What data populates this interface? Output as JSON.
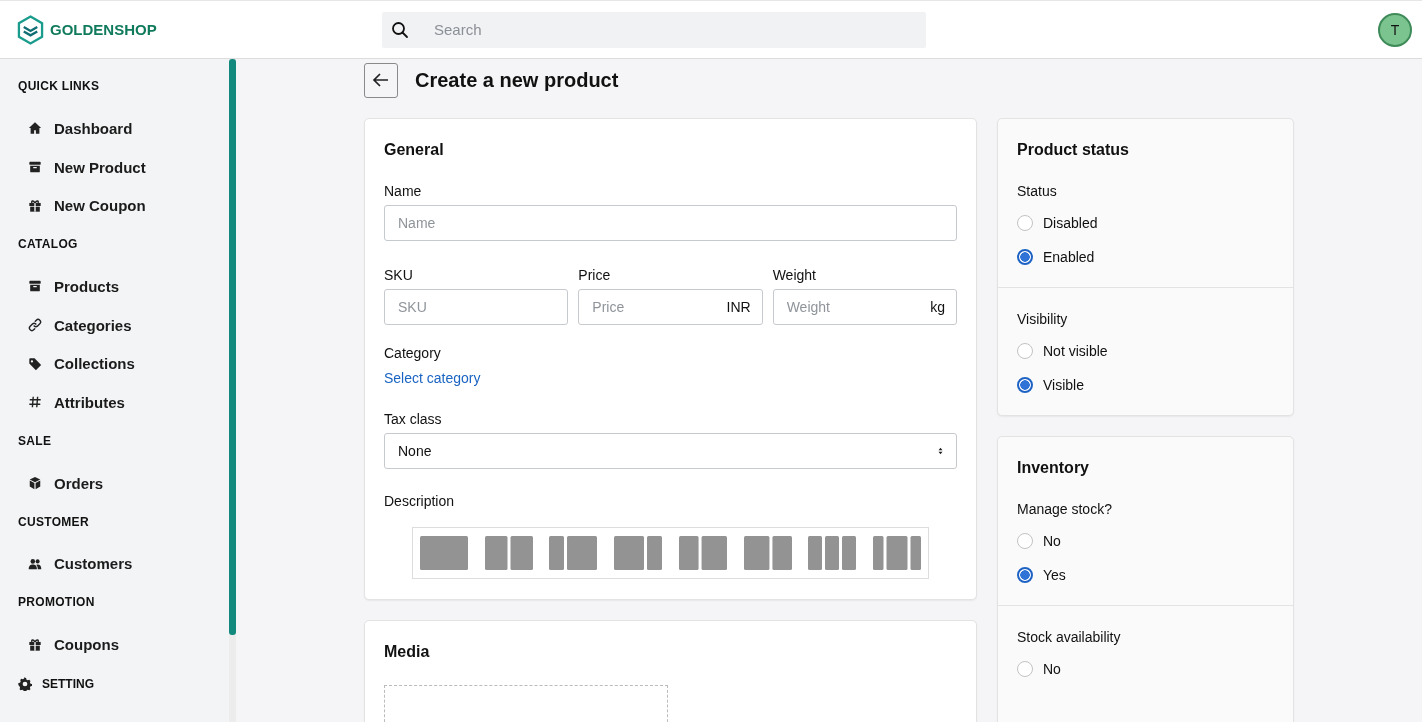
{
  "brand": {
    "name": "GOLDENSHOP"
  },
  "search": {
    "placeholder": "Search"
  },
  "user": {
    "initial": "T"
  },
  "sidebar": {
    "sections": [
      {
        "title": "QUICK LINKS",
        "items": [
          {
            "label": "Dashboard",
            "kind": "home"
          },
          {
            "label": "New Product",
            "kind": "archive"
          },
          {
            "label": "New Coupon",
            "kind": "gift"
          }
        ]
      },
      {
        "title": "CATALOG",
        "items": [
          {
            "label": "Products",
            "kind": "archive"
          },
          {
            "label": "Categories",
            "kind": "link"
          },
          {
            "label": "Collections",
            "kind": "tag"
          },
          {
            "label": "Attributes",
            "kind": "hash"
          }
        ]
      },
      {
        "title": "SALE",
        "items": [
          {
            "label": "Orders",
            "kind": "cube"
          }
        ]
      },
      {
        "title": "CUSTOMER",
        "items": [
          {
            "label": "Customers",
            "kind": "users"
          }
        ]
      },
      {
        "title": "PROMOTION",
        "items": [
          {
            "label": "Coupons",
            "kind": "gift"
          }
        ]
      }
    ],
    "setting": "SETTING"
  },
  "page": {
    "title": "Create a new product"
  },
  "general": {
    "title": "General",
    "name": {
      "label": "Name",
      "placeholder": "Name"
    },
    "sku": {
      "label": "SKU",
      "placeholder": "SKU"
    },
    "price": {
      "label": "Price",
      "placeholder": "Price",
      "suffix": "INR"
    },
    "weight": {
      "label": "Weight",
      "placeholder": "Weight",
      "suffix": "kg"
    },
    "category": {
      "label": "Category",
      "link": "Select category"
    },
    "tax_class": {
      "label": "Tax class",
      "value": "None"
    },
    "description": {
      "label": "Description"
    }
  },
  "media": {
    "title": "Media"
  },
  "product_status": {
    "title": "Product status",
    "groups": [
      {
        "label": "Status",
        "options": [
          {
            "label": "Disabled",
            "selected": false
          },
          {
            "label": "Enabled",
            "selected": true
          }
        ]
      },
      {
        "label": "Visibility",
        "options": [
          {
            "label": "Not visible",
            "selected": false
          },
          {
            "label": "Visible",
            "selected": true
          }
        ]
      }
    ]
  },
  "inventory": {
    "title": "Inventory",
    "groups": [
      {
        "label": "Manage stock?",
        "options": [
          {
            "label": "No",
            "selected": false
          },
          {
            "label": "Yes",
            "selected": true
          }
        ]
      },
      {
        "label": "Stock availability",
        "options": [
          {
            "label": "No",
            "selected": false
          }
        ]
      }
    ]
  }
}
